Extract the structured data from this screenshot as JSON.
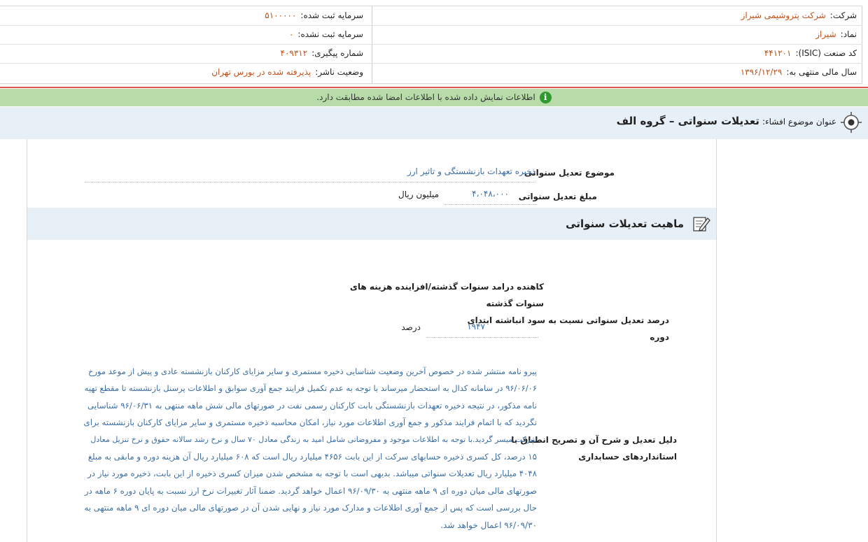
{
  "header": {
    "company_label": "شرکت:",
    "company_value": "شرکت پتروشیمی شیراز",
    "registered_capital_label": "سرمایه ثبت شده:",
    "registered_capital_value": "۵۱۰۰۰۰۰",
    "symbol_label": "نماد:",
    "symbol_value": "شیراز",
    "unregistered_capital_label": "سرمایه ثبت نشده:",
    "unregistered_capital_value": "۰",
    "isic_label": "کد صنعت (ISIC):",
    "isic_value": "۴۴۱۲۰۱",
    "tracking_label": "شماره پیگیری:",
    "tracking_value": "۴۰۹۳۱۲",
    "fiscal_year_label": "سال مالی منتهی به:",
    "fiscal_year_value": "۱۳۹۶/۱۲/۲۹",
    "publisher_status_label": "وضعیت ناشر:",
    "publisher_status_value": "پذیرفته شده در بورس تهران"
  },
  "notice": {
    "text": "اطلاعات نمایش داده شده با اطلاعات امضا شده مطابقت دارد.",
    "icon": "info-icon",
    "bg_color": "#b8dca9"
  },
  "subject": {
    "label": "عنوان موضوع افشاء:",
    "value": "تعدیلات سنواتی – گروه الف",
    "icon": "target-icon"
  },
  "form": {
    "adjustment_subject_label": "موضوع تعدیل سنواتی",
    "adjustment_subject_value": "ذخیره تعهدات بازنشستگی و تاثیر ارز",
    "adjustment_amount_label": "مبلغ تعدیل سنواتی",
    "adjustment_amount_value": "۴،۰۴۸،۰۰۰",
    "adjustment_amount_unit": "میلیون ریال"
  },
  "nature": {
    "title": "ماهیت تعدیلات سنواتی",
    "icon": "edit-icon",
    "type_line1": "کاهنده درامد سنوات گذشته/افزاینده هزینه های",
    "type_line2": "سنوات گذشته",
    "percent_label_line1": "درصد تعدیل سنواتی نسبت به سود انباشته ابتدای",
    "percent_label_line2": "دوره",
    "percent_value": "۱۹۴۷",
    "percent_unit": "درصد",
    "reason_label_line1": "دلیل تعدیل و شرح آن و تصریح انطباق با",
    "reason_label_line2": "استانداردهای حسابداری",
    "reason_lines": [
      "پیرو نامه منتشر شده در خصوص آخرین وضعیت شناسایی ذخیره مستمری و سایر مزایای کارکنان بازنشسته عادی و پیش از موعد مورخ",
      "۹۶/۰۶/۰۶ در سامانه کدال به استحضار میرساند با توجه به عدم تکمیل فرایند جمع آوری سوابق و اطلاعات پرسنل بازنشسته تا مقطع تهیه",
      "نامه مذکور، در نتیجه ذخیره تعهدات بازنشستگی بابت کارکنان رسمی نفت در صورتهای مالی شش ماهه منتهی به ۹۶/۰۶/۳۱ شناسایی",
      "نگردید که با اتمام فرایند مذکور و جمع آوری اطلاعات مورد نیاز، امکان محاسبه ذخیره مستمری و سایر مزایای کارکنان بازنشسته برای",
      "شرکت میسر گردید.با توجه به اطلاعات موجود و مفروضاتی شامل امید به زندگی معادل ۷۰ سال و نرخ رشد سالانه حقوق و نرخ تنزیل معادل",
      "۱۵ درصد، کل کسری ذخیره حسابهای سرکت از این بابت ۴۶۵۶ میلیارد ریال است که ۶۰۸ میلیارد ریال آن هزینه دوره و مابقی به مبلغ",
      "۴۰۴۸ میلیارد ریال تعدیلات سنواتی میباشد. بدیهی است با توجه به مشخص شدن میزان کسری ذخیره از این بابت، ذخیره مورد نیاز در",
      "صورتهای مالی میان دوره ای ۹ ماهه منتهی به ۹۶/۰۹/۳۰ اعمال خواهد گردید. ضمنا آثار تغییرات نرخ ارز نسبت به پایان دوره ۶ ماهه در",
      "حال بررسی است که پس از جمع آوری اطلاعات و مدارک مورد نیاز و نهایی شدن آن در صورتهای مالی میان دوره ای ۹ ماهه منتهی به",
      "۹۶/۰۹/۳۰ اعمال خواهد شد."
    ]
  }
}
